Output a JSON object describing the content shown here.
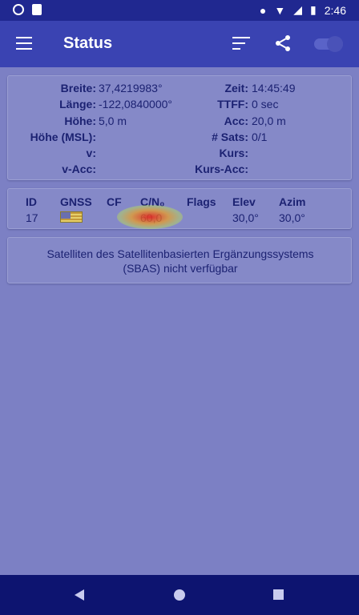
{
  "status_bar": {
    "time": "2:46"
  },
  "app_bar": {
    "title": "Status"
  },
  "fix": {
    "rows": [
      {
        "left_label": "Breite:",
        "left_value": "37,4219983°",
        "right_label": "Zeit:",
        "right_value": "14:45:49"
      },
      {
        "left_label": "Länge:",
        "left_value": "-122,0840000°",
        "right_label": "TTFF:",
        "right_value": "0 sec"
      },
      {
        "left_label": "Höhe:",
        "left_value": "5,0 m",
        "right_label": "Acc:",
        "right_value": "20,0 m"
      },
      {
        "left_label": "Höhe (MSL):",
        "left_value": "",
        "right_label": "# Sats:",
        "right_value": "0/1"
      },
      {
        "left_label": "v:",
        "left_value": "",
        "right_label": "Kurs:",
        "right_value": ""
      },
      {
        "left_label": "v-Acc:",
        "left_value": "",
        "right_label": "Kurs-Acc:",
        "right_value": ""
      }
    ]
  },
  "satellites": {
    "headers": {
      "id": "ID",
      "gnss": "GNSS",
      "cf": "CF",
      "cn0": "C/N₀",
      "flags": "Flags",
      "elev": "Elev",
      "azim": "Azim"
    },
    "rows": [
      {
        "id": "17",
        "gnss_icon": "us-flag-icon",
        "cf": "",
        "cn0": "60,0",
        "flags": "",
        "elev": "30,0°",
        "azim": "30,0°"
      }
    ]
  },
  "sbas": {
    "message_line1": "Satelliten des Satellitenbasierten Ergänzungssystems",
    "message_line2": "(SBAS) nicht verfügbar"
  },
  "colors": {
    "app_bar": "#3a43b2",
    "status_bar": "#202890",
    "background": "#7c80c4",
    "text": "#1c2272",
    "nav_bar": "#0d1470"
  }
}
